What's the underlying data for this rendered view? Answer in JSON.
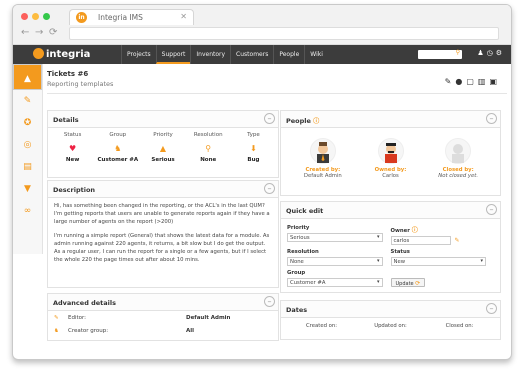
{
  "browser": {
    "tab_title": "Integria IMS",
    "tab_icon": "integria-favicon-icon"
  },
  "app": {
    "logo_text": "integria",
    "nav": [
      "Projects",
      "Support",
      "Inventory",
      "Customers",
      "People",
      "Wiki"
    ],
    "active_nav": "Support"
  },
  "header": {
    "title": "Tickets #6",
    "subtitle": "Reporting templates"
  },
  "details": {
    "title": "Details",
    "columns": [
      {
        "label": "Status",
        "value": "New",
        "icon": "heart-icon",
        "color": "#e24"
      },
      {
        "label": "Group",
        "value": "Customer #A",
        "icon": "group-icon",
        "color": "#f39a1e"
      },
      {
        "label": "Priority",
        "value": "Serious",
        "icon": "priority-icon",
        "color": "#f39a1e"
      },
      {
        "label": "Resolution",
        "value": "None",
        "icon": "resolution-icon",
        "color": "#f39a1e"
      },
      {
        "label": "Type",
        "value": "Bug",
        "icon": "type-icon",
        "color": "#f39a1e"
      }
    ]
  },
  "description": {
    "title": "Description",
    "paragraphs": [
      "Hi, has something been changed in the reporting, or the ACL's in the last QUM? I'm getting reports that users are unable to generate reports again if they have a large number of agents on the report (>200)",
      "I'm running a simple report (General) that shows the latest data for a module. As admin running against 220 agents, it returns, a bit slow but I do get the output.",
      "As a regular user, I can run the report for a single or a few agents, but if I select the whole 220 the page times out after about 10 mins."
    ]
  },
  "advanced": {
    "title": "Advanced details",
    "rows": [
      {
        "key": "Editor:",
        "value": "Default Admin",
        "icon": "pencil-icon"
      },
      {
        "key": "Creator group:",
        "value": "All",
        "icon": "group-icon"
      }
    ]
  },
  "people": {
    "title": "People",
    "list": [
      {
        "role": "Created by:",
        "name": "Default Admin",
        "italic": false,
        "icon": "admin-avatar-icon"
      },
      {
        "role": "Owned by:",
        "name": "Carlos",
        "italic": false,
        "icon": "carlos-avatar-icon"
      },
      {
        "role": "Closed by:",
        "name": "Not closed yet.",
        "italic": true,
        "icon": "empty-avatar-icon"
      }
    ]
  },
  "quick_edit": {
    "title": "Quick edit",
    "priority_label": "Priority",
    "priority_value": "Serious",
    "owner_label": "Owner",
    "owner_value": "carlos",
    "resolution_label": "Resolution",
    "resolution_value": "None",
    "status_label": "Status",
    "status_value": "New",
    "group_label": "Group",
    "group_value": "Customer #A",
    "update_label": "Update"
  },
  "dates": {
    "title": "Dates",
    "created_label": "Created on:",
    "updated_label": "Updated on:",
    "closed_label": "Closed on:"
  }
}
